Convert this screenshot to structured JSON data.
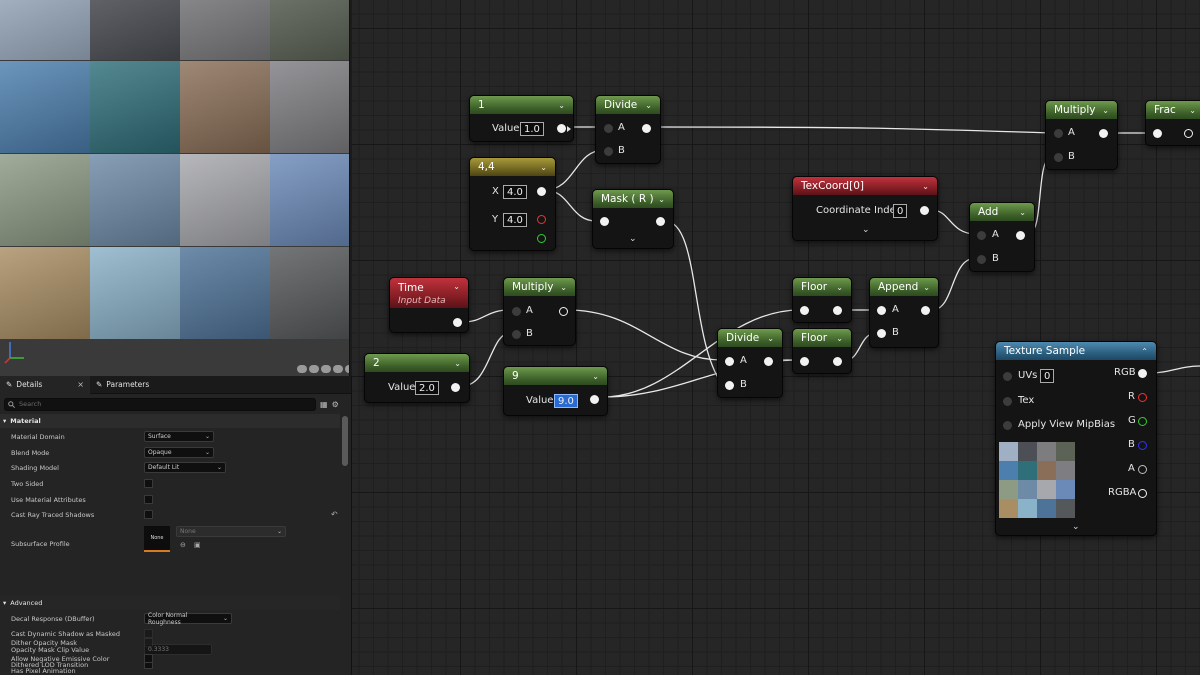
{
  "viewport": {
    "tiles": [
      {
        "color": "#9fb0c4"
      },
      {
        "color": "#4c4f55"
      },
      {
        "color": "#7d7d80"
      },
      {
        "color": "#5c6356"
      },
      {
        "color": "#4c7fae"
      },
      {
        "color": "#2f6f7a"
      },
      {
        "color": "#8a6e57"
      },
      {
        "color": "#7e7e82"
      },
      {
        "color": "#8d9a84"
      },
      {
        "color": "#6d8aa6"
      },
      {
        "color": "#a7a8ad"
      },
      {
        "color": "#6b8ab8"
      },
      {
        "color": "#a98e63"
      },
      {
        "color": "#8ab2c8"
      },
      {
        "color": "#4e7398"
      },
      {
        "color": "#55585a"
      }
    ]
  },
  "details": {
    "tabs": [
      {
        "label": "Details",
        "icon": "pencil-icon"
      },
      {
        "label": "Parameters",
        "icon": "sliders-icon"
      }
    ],
    "search_placeholder": "Search",
    "material_header": "Material",
    "advanced_header": "Advanced",
    "properties": {
      "material_domain": {
        "label": "Material Domain",
        "value": "Surface"
      },
      "blend_mode": {
        "label": "Blend Mode",
        "value": "Opaque"
      },
      "shading_model": {
        "label": "Shading Model",
        "value": "Default Lit"
      },
      "two_sided": {
        "label": "Two Sided"
      },
      "use_material_attributes": {
        "label": "Use Material Attributes"
      },
      "cast_ray_traced_shadows": {
        "label": "Cast Ray Traced Shadows"
      },
      "subsurface_profile": {
        "label": "Subsurface Profile",
        "thumb_label": "None",
        "value": "None"
      },
      "decal_response": {
        "label": "Decal Response (DBuffer)",
        "value": "Color Normal Roughness"
      },
      "cast_dynamic_shadow_as_masked": {
        "label": "Cast Dynamic Shadow as Masked"
      },
      "opacity_mask_clip_value": {
        "label": "Opacity Mask Clip Value",
        "value": "0.3333"
      },
      "dithered_lod_transition": {
        "label": "Dithered LOD Transition"
      },
      "dither_opacity_mask": {
        "label": "Dither Opacity Mask"
      },
      "allow_negative_emissive_color": {
        "label": "Allow Negative Emissive Color"
      },
      "has_pixel_animation": {
        "label": "Has Pixel Animation"
      }
    }
  },
  "graph": {
    "nodes": {
      "const1": {
        "title": "1",
        "value_label": "Value",
        "value": "1.0"
      },
      "divide1": {
        "title": "Divide",
        "pin_a": "A",
        "pin_b": "B"
      },
      "const44": {
        "title": "4,4",
        "x_label": "X",
        "x_value": "4.0",
        "y_label": "Y",
        "y_value": "4.0"
      },
      "mask": {
        "title": "Mask ( R )"
      },
      "time": {
        "title": "Time",
        "subtitle": "Input Data"
      },
      "multiply1": {
        "title": "Multiply",
        "pin_a": "A",
        "pin_b": "B"
      },
      "const2": {
        "title": "2",
        "value_label": "Value",
        "value": "2.0"
      },
      "const9": {
        "title": "9",
        "value_label": "Value",
        "value": "9.0"
      },
      "texcoord": {
        "title": "TexCoord[0]",
        "label": "Coordinate Index",
        "value": "0"
      },
      "add": {
        "title": "Add",
        "pin_a": "A",
        "pin_b": "B"
      },
      "floor1": {
        "title": "Floor"
      },
      "floor2": {
        "title": "Floor"
      },
      "append": {
        "title": "Append",
        "pin_a": "A",
        "pin_b": "B"
      },
      "divide2": {
        "title": "Divide",
        "pin_a": "A",
        "pin_b": "B"
      },
      "multiply2": {
        "title": "Multiply",
        "pin_a": "A",
        "pin_b": "B"
      },
      "frac": {
        "title": "Frac"
      },
      "texture_sample": {
        "title": "Texture Sample",
        "inputs": [
          "UVs",
          "Tex",
          "Apply View MipBias"
        ],
        "uvs_value": "0",
        "outputs": [
          "RGB",
          "R",
          "G",
          "B",
          "A",
          "RGBA"
        ],
        "output_colors": {
          "RGB": "#f2f2f2",
          "R": "#ee3333",
          "G": "#33cc33",
          "B": "#3333ee",
          "A": "#bbbbbb",
          "RGBA": "#f2f2f2"
        }
      }
    }
  }
}
